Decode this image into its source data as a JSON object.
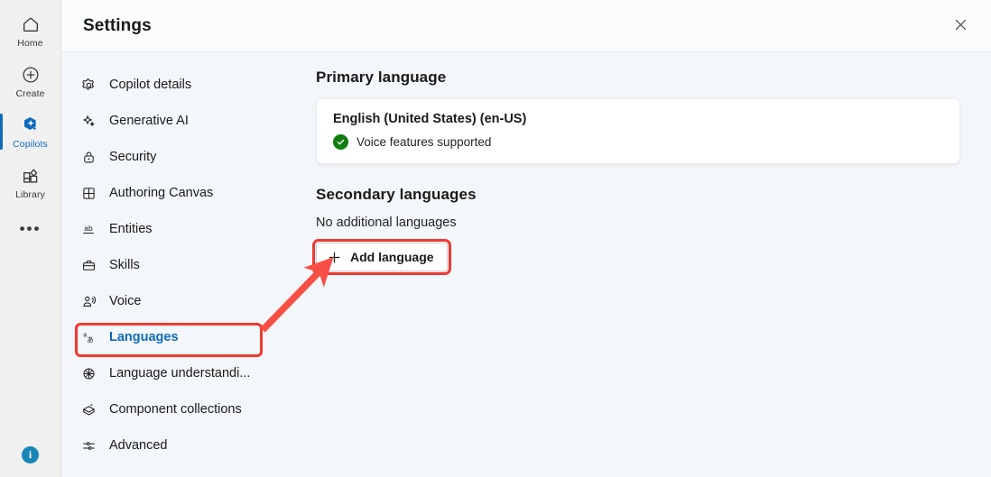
{
  "rail": {
    "items": [
      {
        "label": "Home",
        "icon": "home-icon",
        "active": false
      },
      {
        "label": "Create",
        "icon": "plus-circle-icon",
        "active": false
      },
      {
        "label": "Copilots",
        "icon": "copilot-sparkle-icon",
        "active": true
      },
      {
        "label": "Library",
        "icon": "library-grid-icon",
        "active": false
      }
    ],
    "more_label": "•••",
    "info_label": "i"
  },
  "header": {
    "title": "Settings",
    "close_label": "Close"
  },
  "nav": {
    "items": [
      {
        "label": "Copilot details",
        "icon": "gear-icon"
      },
      {
        "label": "Generative AI",
        "icon": "sparkle-icon"
      },
      {
        "label": "Security",
        "icon": "lock-icon"
      },
      {
        "label": "Authoring Canvas",
        "icon": "grid-icon"
      },
      {
        "label": "Entities",
        "icon": "ab-underline-icon"
      },
      {
        "label": "Skills",
        "icon": "briefcase-icon"
      },
      {
        "label": "Voice",
        "icon": "person-speaking-icon"
      },
      {
        "label": "Languages",
        "icon": "translate-icon"
      },
      {
        "label": "Language understandi...",
        "icon": "brain-icon"
      },
      {
        "label": "Component collections",
        "icon": "component-icon"
      },
      {
        "label": "Advanced",
        "icon": "sliders-icon"
      }
    ],
    "selected_index": 7
  },
  "content": {
    "primary_title": "Primary language",
    "primary_language": "English (United States) (en-US)",
    "voice_status": "Voice features supported",
    "secondary_title": "Secondary languages",
    "secondary_empty": "No additional languages",
    "add_language_label": "Add language"
  },
  "annotations": {
    "accent_color": "#f03a2f",
    "arrow_from": "languages-nav-item",
    "arrow_to": "add-language-button"
  },
  "colors": {
    "accent_blue": "#0f6cbd",
    "annotation_red": "#f03a2f",
    "success_green": "#107c10",
    "rail_bg": "#f0f0f0",
    "pane_bg": "#f3f6fa",
    "card_bg": "#ffffff"
  }
}
